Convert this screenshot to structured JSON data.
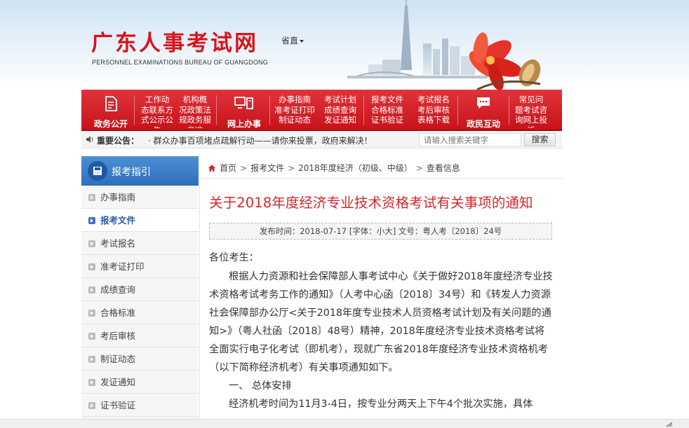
{
  "header": {
    "logo_cn": "广东人事考试网",
    "logo_en": "PERSONNEL EXAMINATIONS BUREAU OF GUANGDONG",
    "site_select": "省直"
  },
  "nav": {
    "big_items": [
      {
        "label": "政务公开",
        "icon": "document-icon"
      },
      {
        "label": "网上办事",
        "icon": "computer-icon"
      },
      {
        "label": "政民互动",
        "icon": "chat-icon"
      }
    ],
    "col1": [
      "工作动",
      "态",
      "联系方",
      "式",
      "公示公",
      "告"
    ],
    "col2": [
      "机构概",
      "况",
      "政策法",
      "规",
      "政务服",
      "务",
      "准"
    ],
    "col3": [
      "办事指南",
      "准考证打",
      "印",
      "制证动态"
    ],
    "col4": [
      "考试计划",
      "成绩查询",
      "发证通知"
    ],
    "col5": [
      "报考文件",
      "合格标准",
      "证书验证"
    ],
    "col6": [
      "考试报名",
      "考后审核",
      "表格下载"
    ],
    "col7": [
      "常见问",
      "题",
      "考试咨",
      "询",
      "网上投",
      "诉"
    ]
  },
  "notice": {
    "label": "重要公告：",
    "text": "·  群众办事百项堵点疏解行动——请你来投票，政府来解决！",
    "search_placeholder": "请输入搜索关键字",
    "search_button": "搜索"
  },
  "sidebar": {
    "title": "报考指引",
    "items": [
      {
        "label": "办事指南",
        "active": false
      },
      {
        "label": "报考文件",
        "active": true
      },
      {
        "label": "考试报名",
        "active": false
      },
      {
        "label": "准考证打印",
        "active": false
      },
      {
        "label": "成绩查询",
        "active": false
      },
      {
        "label": "合格标准",
        "active": false
      },
      {
        "label": "考后审核",
        "active": false
      },
      {
        "label": "制证动态",
        "active": false
      },
      {
        "label": "发证通知",
        "active": false
      },
      {
        "label": "证书验证",
        "active": false
      }
    ]
  },
  "breadcrumb": {
    "home": "首页",
    "level1": "报考文件",
    "level2": "2018年度经济（初级、中级）",
    "level3": "查看信息",
    "separator": ">"
  },
  "article": {
    "title": "关于2018年度经济专业技术资格考试有关事项的通知",
    "meta_prefix": "发布时间：2018-07-17  [字体：",
    "meta_font_small": "小",
    "meta_font_large": "大",
    "meta_suffix": "]  文号：粤人考〔2018〕24号",
    "greeting": "各位考生：",
    "paragraph1": "根据人力资源和社会保障部人事考试中心《关于做好2018年度经济专业技术资格考试考务工作的通知》（人考中心函〔2018〕34号）和《转发人力资源社会保障部办公厅<关于2018年度专业技术人员资格考试计划及有关问题的通知>》（粤人社函〔2018〕48号）精神，2018年度经济专业技术资格考试将全面实行电子化考试（即机考），现就广东省2018年度经济专业技术资格机考（以下简称经济机考）有关事项通知如下。",
    "heading1": "一、 总体安排",
    "paragraph2": "经济机考时间为11月3-4日，按专业分两天上下午4个批次实施，具体"
  },
  "colors": {
    "brand_red": "#d7141b",
    "title_red": "#d4262c",
    "sidebar_blue": "#2d6fbb"
  }
}
